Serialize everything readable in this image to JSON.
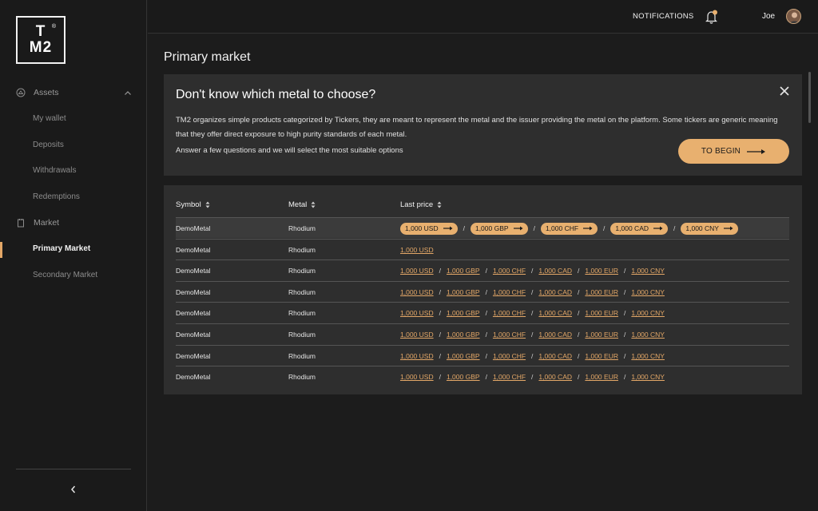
{
  "logo": {
    "line1": "T",
    "line2": "M2",
    "reg": "®"
  },
  "sidebar": {
    "groups": [
      {
        "label": "Assets",
        "icon": "assets-icon"
      },
      {
        "label": "Market",
        "icon": "market-icon"
      }
    ],
    "items": [
      {
        "label": "My wallet"
      },
      {
        "label": "Deposits"
      },
      {
        "label": "Withdrawals"
      },
      {
        "label": "Redemptions"
      },
      {
        "label": "Primary Market",
        "active": true
      },
      {
        "label": "Secondary Market"
      }
    ]
  },
  "topbar": {
    "notifications": "NOTIFICATIONS",
    "user": "Joe"
  },
  "page": {
    "title": "Primary market"
  },
  "promo": {
    "title": "Don't know which metal to choose?",
    "text": "TM2 organizes simple products categorized by Tickers, they are meant to represent the metal and the issuer providing the metal on the platform. Some tickers are generic meaning that they offer direct exposure to high purity standards of each metal.",
    "subtext": "Answer a few questions and we will select the most suitable options",
    "button": "TO BEGIN"
  },
  "table": {
    "headers": {
      "symbol": "Symbol",
      "metal": "Metal",
      "price": "Last price"
    },
    "rows": [
      {
        "symbol": "DemoMetal",
        "metal": "Rhodium",
        "style": "pills",
        "prices": [
          "1,000 USD",
          "1,000 GBP",
          "1,000 CHF",
          "1,000 CAD",
          "1,000 CNY"
        ]
      },
      {
        "symbol": "DemoMetal",
        "metal": "Rhodium",
        "style": "links",
        "prices": [
          "1,000 USD"
        ]
      },
      {
        "symbol": "DemoMetal",
        "metal": "Rhodium",
        "style": "links",
        "prices": [
          "1,000 USD",
          "1,000 GBP",
          "1,000 CHF",
          "1,000 CAD",
          "1,000 EUR",
          "1,000 CNY"
        ]
      },
      {
        "symbol": "DemoMetal",
        "metal": "Rhodium",
        "style": "links",
        "prices": [
          "1,000 USD",
          "1,000 GBP",
          "1,000 CHF",
          "1,000 CAD",
          "1,000 EUR",
          "1,000 CNY"
        ]
      },
      {
        "symbol": "DemoMetal",
        "metal": "Rhodium",
        "style": "links",
        "prices": [
          "1,000 USD",
          "1,000 GBP",
          "1,000 CHF",
          "1,000 CAD",
          "1,000 EUR",
          "1,000 CNY"
        ]
      },
      {
        "symbol": "DemoMetal",
        "metal": "Rhodium",
        "style": "links",
        "prices": [
          "1,000 USD",
          "1,000 GBP",
          "1,000 CHF",
          "1,000 CAD",
          "1,000 EUR",
          "1,000 CNY"
        ]
      },
      {
        "symbol": "DemoMetal",
        "metal": "Rhodium",
        "style": "links",
        "prices": [
          "1,000 USD",
          "1,000 GBP",
          "1,000 CHF",
          "1,000 CAD",
          "1,000 EUR",
          "1,000 CNY"
        ]
      },
      {
        "symbol": "DemoMetal",
        "metal": "Rhodium",
        "style": "links",
        "prices": [
          "1,000 USD",
          "1,000 GBP",
          "1,000 CHF",
          "1,000 CAD",
          "1,000 EUR",
          "1,000 CNY"
        ]
      }
    ]
  },
  "colors": {
    "accent": "#e8b06f",
    "background": "#1c1c1c",
    "card": "#2e2e2e"
  }
}
